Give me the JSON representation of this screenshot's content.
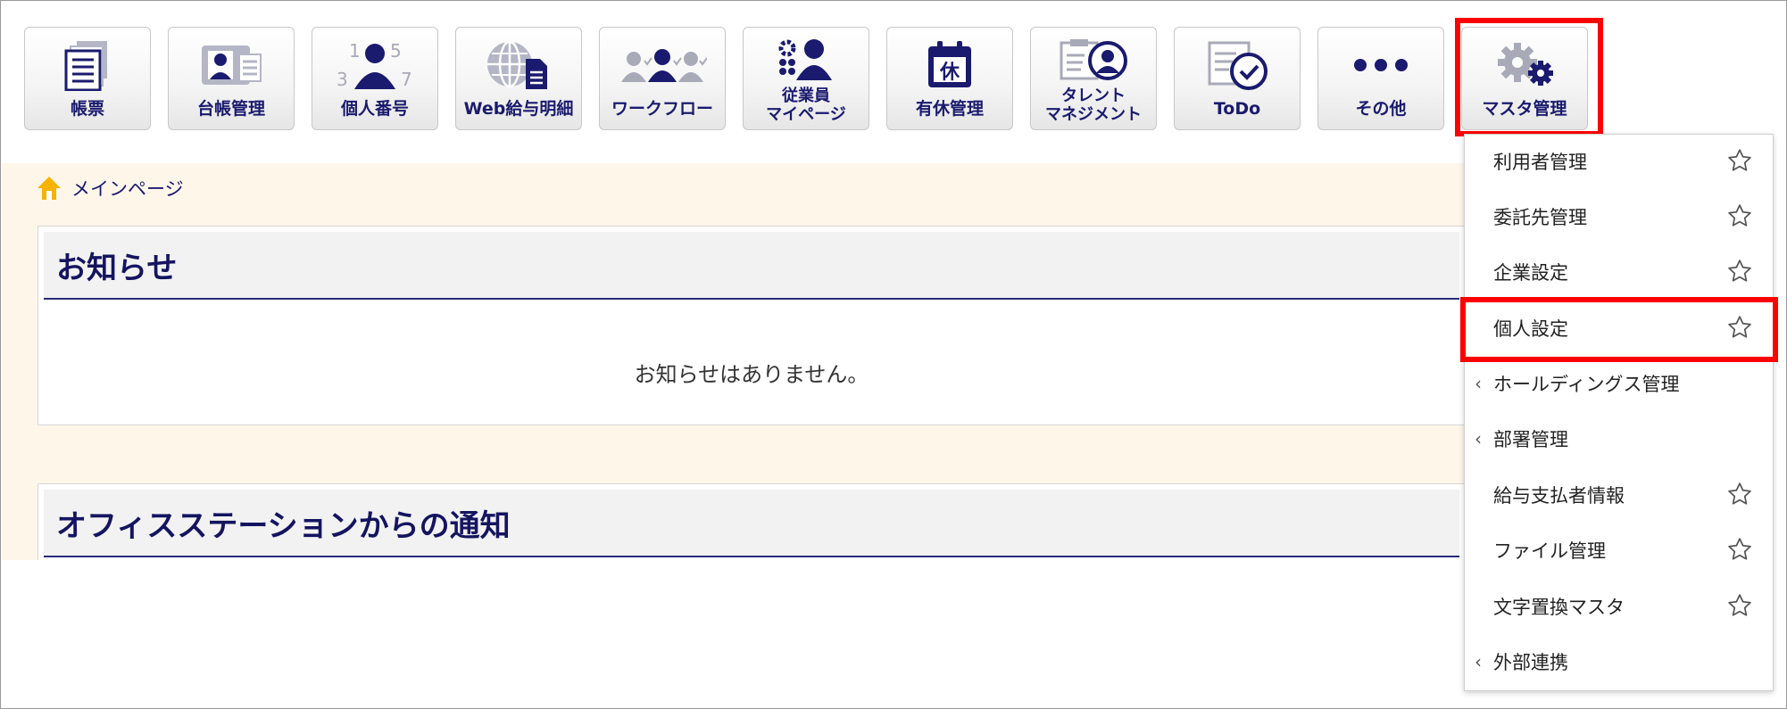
{
  "toolbar": {
    "items": [
      {
        "label": "帳票",
        "icon": "document-stack-icon"
      },
      {
        "label": "台帳管理",
        "icon": "id-card-icon"
      },
      {
        "label": "個人番号",
        "icon": "person-number-icon"
      },
      {
        "label": "Web給与明細",
        "icon": "globe-document-icon"
      },
      {
        "label": "ワークフロー",
        "icon": "people-flow-icon"
      },
      {
        "label": "従業員\nマイページ",
        "icon": "employee-icon"
      },
      {
        "label": "有休管理",
        "icon": "calendar-holiday-icon"
      },
      {
        "label": "タレント\nマネジメント",
        "icon": "clipboard-person-icon"
      },
      {
        "label": "ToDo",
        "icon": "checklist-icon"
      },
      {
        "label": "その他",
        "icon": "more-dots-icon"
      },
      {
        "label": "マスタ管理",
        "icon": "gears-icon"
      }
    ],
    "calendar_glyph": "休",
    "number_digits": [
      "1",
      "5",
      "3",
      "7"
    ]
  },
  "breadcrumb": {
    "label": "メインページ"
  },
  "notices": {
    "title": "お知らせ",
    "empty_text": "お知らせはありません。"
  },
  "office_station": {
    "title": "オフィスステーションからの通知"
  },
  "master_menu": {
    "items": [
      {
        "label": "利用者管理",
        "star": true,
        "chevron": false
      },
      {
        "label": "委託先管理",
        "star": true,
        "chevron": false
      },
      {
        "label": "企業設定",
        "star": true,
        "chevron": false
      },
      {
        "label": "個人設定",
        "star": true,
        "chevron": false
      },
      {
        "label": "ホールディングス管理",
        "star": false,
        "chevron": true
      },
      {
        "label": "部署管理",
        "star": false,
        "chevron": true
      },
      {
        "label": "給与支払者情報",
        "star": true,
        "chevron": false
      },
      {
        "label": "ファイル管理",
        "star": true,
        "chevron": false
      },
      {
        "label": "文字置換マスタ",
        "star": true,
        "chevron": false
      },
      {
        "label": "外部連携",
        "star": false,
        "chevron": true
      }
    ],
    "chevron_glyph": "‹"
  },
  "colors": {
    "navy": "#1a1a6e",
    "highlight": "#ff0000",
    "content_bg": "#fff6ea",
    "icon_gray": "#a9aab8"
  }
}
